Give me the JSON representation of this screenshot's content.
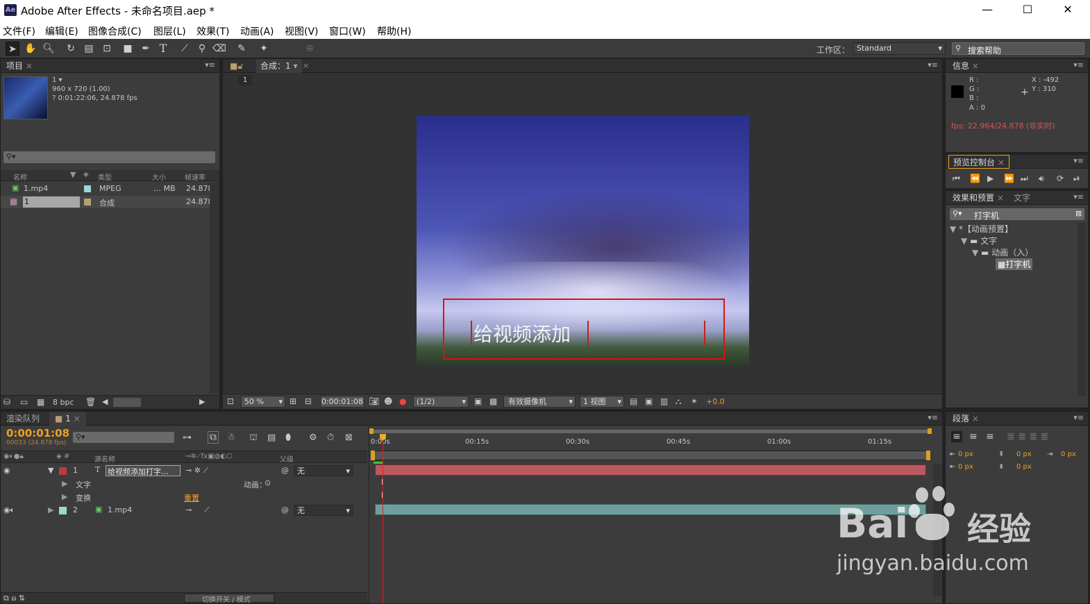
{
  "window": {
    "app_icon": "Ae",
    "title": "Adobe After Effects - 未命名项目.aep *",
    "min": "—",
    "max": "☐",
    "close": "✕"
  },
  "menu": [
    "文件(F)",
    "编辑(E)",
    "图像合成(C)",
    "图层(L)",
    "效果(T)",
    "动画(A)",
    "视图(V)",
    "窗口(W)",
    "帮助(H)"
  ],
  "toolbar": {
    "tools": [
      "selection-tool",
      "hand-tool",
      "zoom-tool",
      "rotate-tool",
      "camera-tool",
      "pan-behind-tool",
      "rectangle-tool",
      "pen-tool",
      "type-tool",
      "brush-tool",
      "clone-stamp-tool",
      "eraser-tool",
      "roto-brush-tool",
      "puppet-tool"
    ],
    "workspace_label": "工作区：",
    "workspace_value": "Standard",
    "search_help": "搜索帮助"
  },
  "project": {
    "tab": "项目",
    "item_name": "1 ▾",
    "item_size": "960 x 720 (1.00)",
    "item_duration": "? 0:01:22:06, 24.878 fps",
    "columns": [
      "名称",
      "类型",
      "大小",
      "帧速率"
    ],
    "rows": [
      {
        "name": "1.mp4",
        "type": "MPEG",
        "size": "… MB",
        "fps": "24.878"
      },
      {
        "name": "1",
        "type": "合成",
        "size": "",
        "fps": "24.878"
      }
    ],
    "bpc": "8 bpc"
  },
  "comp": {
    "tab": "合成：1",
    "breadcrumb": "1",
    "zoom": "50 %",
    "timecode": "0:00:01:08",
    "resolution": "(1/2)",
    "camera": "有效摄像机",
    "views": "1 视图",
    "exposure": "+0.0",
    "overlay_text": "给视频添加"
  },
  "info": {
    "tab": "信息",
    "r": "R :",
    "g": "G :",
    "b": "B :",
    "a": "A : 0",
    "x": "X : -492",
    "y": "Y : 310",
    "fps": "fps: 22.964/24.878 (非实时)"
  },
  "preview": {
    "tab": "预览控制台"
  },
  "effects": {
    "tab": "效果和预置",
    "tab2": "文字",
    "search": "打字机",
    "tree": [
      {
        "label": "*【动画预置】",
        "level": 0
      },
      {
        "label": "文字",
        "level": 1
      },
      {
        "label": "动画（入）",
        "level": 2
      },
      {
        "label": "打字机",
        "level": 3
      }
    ]
  },
  "timeline": {
    "tab_render": "渲染队列",
    "tab_comp": "1",
    "current_time": "0:00:01:08",
    "frame_info": "00033 (24.878 fps)",
    "col_source": "源名称",
    "col_parent": "父级",
    "ruler": [
      "0:00s",
      "00:15s",
      "00:30s",
      "00:45s",
      "01:00s",
      "01:15s"
    ],
    "layers": [
      {
        "num": "1",
        "name": "给视频添加打字…",
        "parent": "无",
        "color": "#c0393b",
        "bar": "#b85a5f"
      },
      {
        "num": "2",
        "name": "1.mp4",
        "parent": "无",
        "color": "#9ad6d4",
        "bar": "#6f9f9c"
      }
    ],
    "sub_text": "文字",
    "sub_animate": "动画：",
    "sub_transform": "变换",
    "sub_reset": "重置",
    "footer": "切换开关 / 模式"
  },
  "paragraph": {
    "tab": "段落",
    "vals": [
      "0 px",
      "0 px",
      "0 px",
      "0 px",
      "0 px"
    ]
  },
  "watermark": {
    "line1": "Bai",
    "line2": "经验",
    "url": "jingyan.baidu.com"
  }
}
